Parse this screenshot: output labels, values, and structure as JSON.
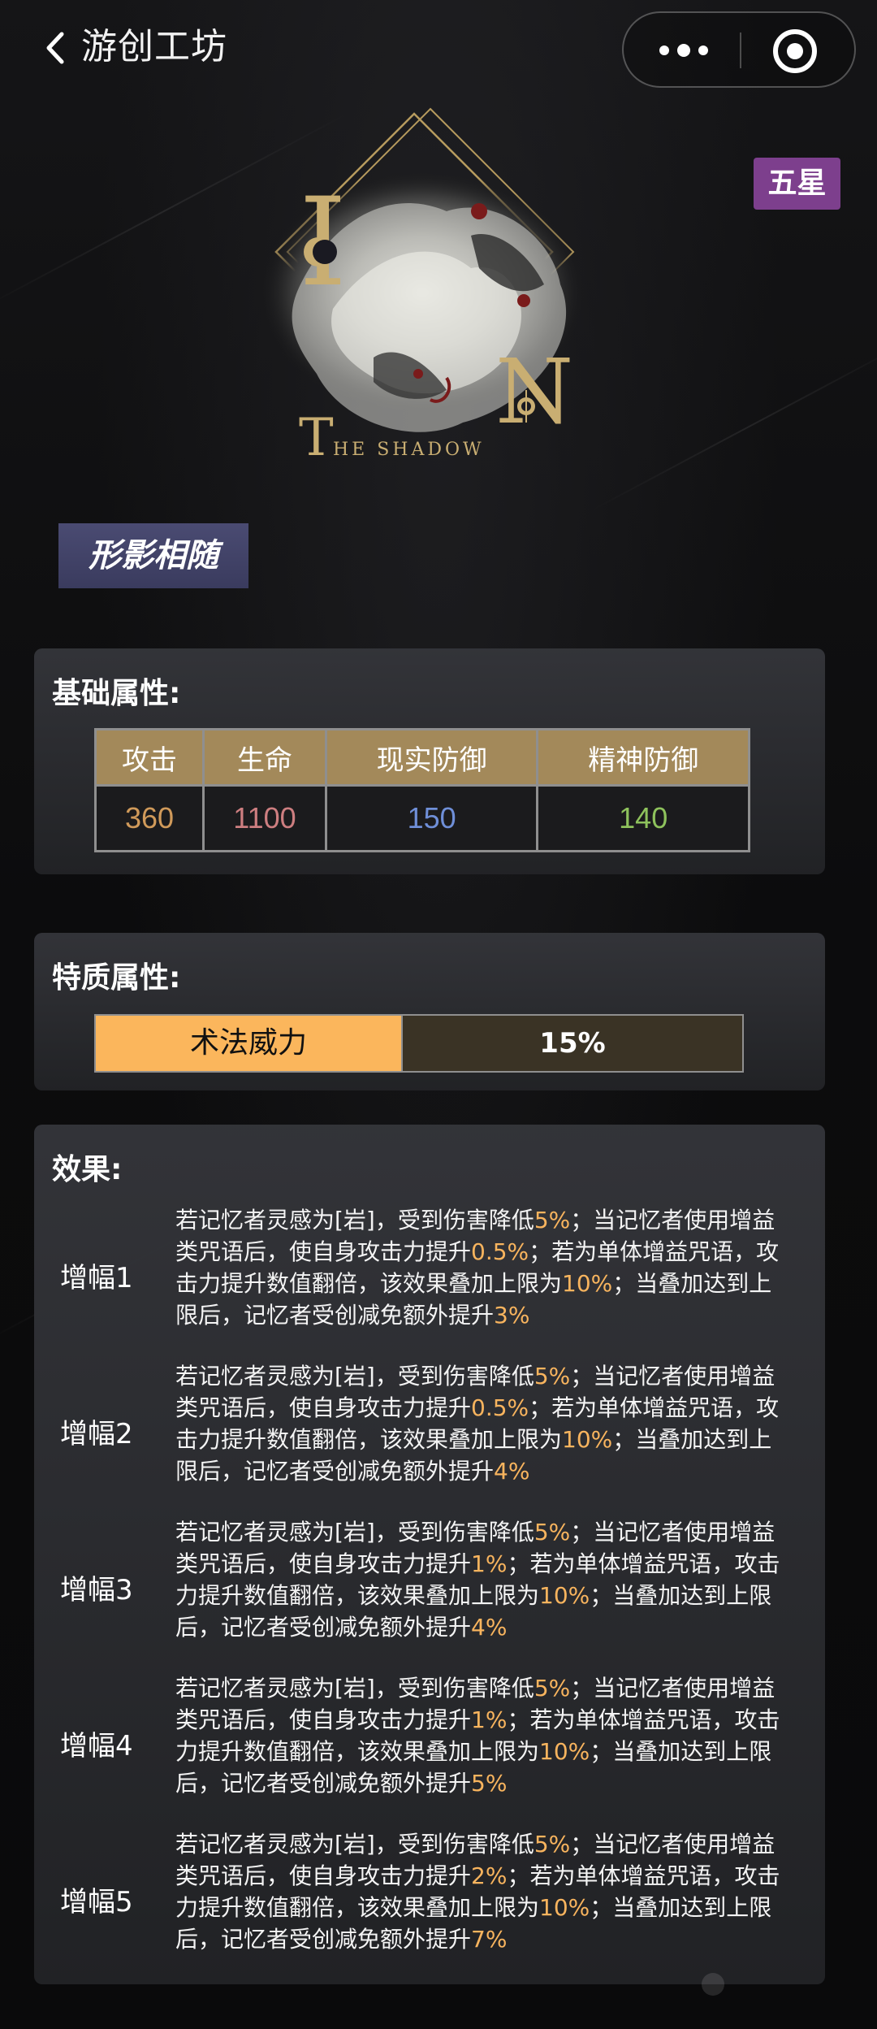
{
  "header": {
    "title": "游创工坊"
  },
  "hero": {
    "logo_text": "THE SHADOW",
    "letter_top": "I",
    "letter_mid": "N",
    "letter_small": "T"
  },
  "rarity": "五星",
  "name": "形影相随",
  "base_stats": {
    "title": "基础属性:",
    "headers": [
      "攻击",
      "生命",
      "现实防御",
      "精神防御"
    ],
    "values": [
      "360",
      "1100",
      "150",
      "140"
    ],
    "colors": [
      "#d09a5a",
      "#cd7e80",
      "#6f8fd8",
      "#8ec25c"
    ]
  },
  "trait": {
    "title": "特质属性:",
    "name": "术法威力",
    "value": "15%"
  },
  "effects": {
    "title": "效果:",
    "items": [
      {
        "label": "增幅1",
        "parts": [
          {
            "t": "若记忆者灵感为[岩]，受到伤害降低"
          },
          {
            "t": "5%",
            "hl": true
          },
          {
            "t": "；当记忆者使用增益类咒语后，使自身攻击力提升"
          },
          {
            "t": "0.5%",
            "hl": true
          },
          {
            "t": "；若为单体增益咒语，攻击力提升数值翻倍，该效果叠加上限为"
          },
          {
            "t": "10%",
            "hl": true
          },
          {
            "t": "；当叠加达到上限后，记忆者受创减免额外提升"
          },
          {
            "t": "3%",
            "hl": true
          }
        ]
      },
      {
        "label": "增幅2",
        "parts": [
          {
            "t": "若记忆者灵感为[岩]，受到伤害降低"
          },
          {
            "t": "5%",
            "hl": true
          },
          {
            "t": "；当记忆者使用增益类咒语后，使自身攻击力提升"
          },
          {
            "t": "0.5%",
            "hl": true
          },
          {
            "t": "；若为单体增益咒语，攻击力提升数值翻倍，该效果叠加上限为"
          },
          {
            "t": "10%",
            "hl": true
          },
          {
            "t": "；当叠加达到上限后，记忆者受创减免额外提升"
          },
          {
            "t": "4%",
            "hl": true
          }
        ]
      },
      {
        "label": "增幅3",
        "parts": [
          {
            "t": "若记忆者灵感为[岩]，受到伤害降低"
          },
          {
            "t": "5%",
            "hl": true
          },
          {
            "t": "；当记忆者使用增益类咒语后，使自身攻击力提升"
          },
          {
            "t": "1%",
            "hl": true
          },
          {
            "t": "；若为单体增益咒语，攻击力提升数值翻倍，该效果叠加上限为"
          },
          {
            "t": "10%",
            "hl": true
          },
          {
            "t": "；当叠加达到上限后，记忆者受创减免额外提升"
          },
          {
            "t": "4%",
            "hl": true
          }
        ]
      },
      {
        "label": "增幅4",
        "parts": [
          {
            "t": "若记忆者灵感为[岩]，受到伤害降低"
          },
          {
            "t": "5%",
            "hl": true
          },
          {
            "t": "；当记忆者使用增益类咒语后，使自身攻击力提升"
          },
          {
            "t": "1%",
            "hl": true
          },
          {
            "t": "；若为单体增益咒语，攻击力提升数值翻倍，该效果叠加上限为"
          },
          {
            "t": "10%",
            "hl": true
          },
          {
            "t": "；当叠加达到上限后，记忆者受创减免额外提升"
          },
          {
            "t": "5%",
            "hl": true
          }
        ]
      },
      {
        "label": "增幅5",
        "parts": [
          {
            "t": "若记忆者灵感为[岩]，受到伤害降低"
          },
          {
            "t": "5%",
            "hl": true
          },
          {
            "t": "；当记忆者使用增益类咒语后，使自身攻击力提升"
          },
          {
            "t": "2%",
            "hl": true
          },
          {
            "t": "；若为单体增益咒语，攻击力提升数值翻倍，该效果叠加上限为"
          },
          {
            "t": "10%",
            "hl": true
          },
          {
            "t": "；当叠加达到上限后，记忆者受创减免额外提升"
          },
          {
            "t": "7%",
            "hl": true
          }
        ]
      }
    ]
  }
}
